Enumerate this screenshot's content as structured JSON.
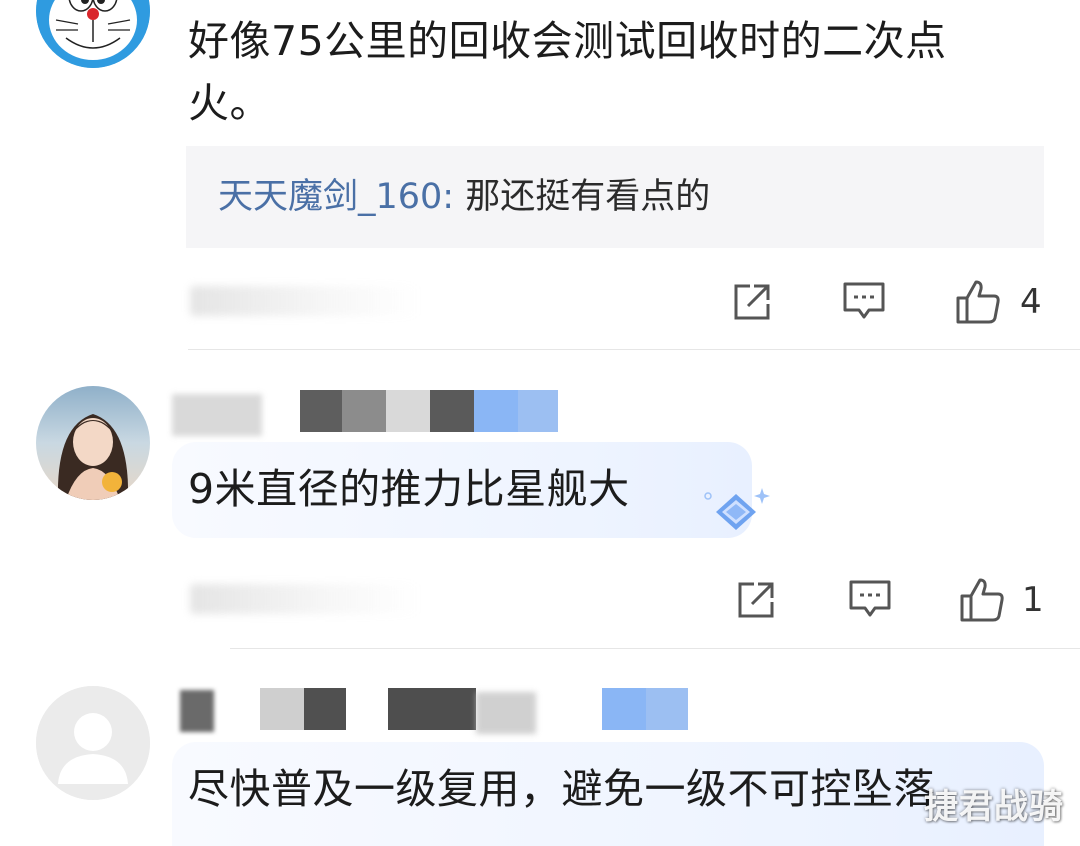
{
  "comments": [
    {
      "text_line1": "好像75公里的回收会测试回收时的二次点",
      "text_line2": "火。",
      "reply": {
        "author": "天天魔剑_160:",
        "text": " 那还挺有看点的"
      },
      "likes": "4"
    },
    {
      "text": "9米直径的推力比星舰大",
      "likes": "1"
    },
    {
      "text": "尽快普及一级复用，避免一级不可控坠落"
    }
  ],
  "watermark": "捷君战骑",
  "icons": {
    "share": "share-icon",
    "comment": "comment-icon",
    "like": "thumbs-up-icon"
  },
  "colors": {
    "reply_author": "#4a70a6",
    "bubble": "#eef4ff",
    "divider": "#e6e6e6"
  }
}
